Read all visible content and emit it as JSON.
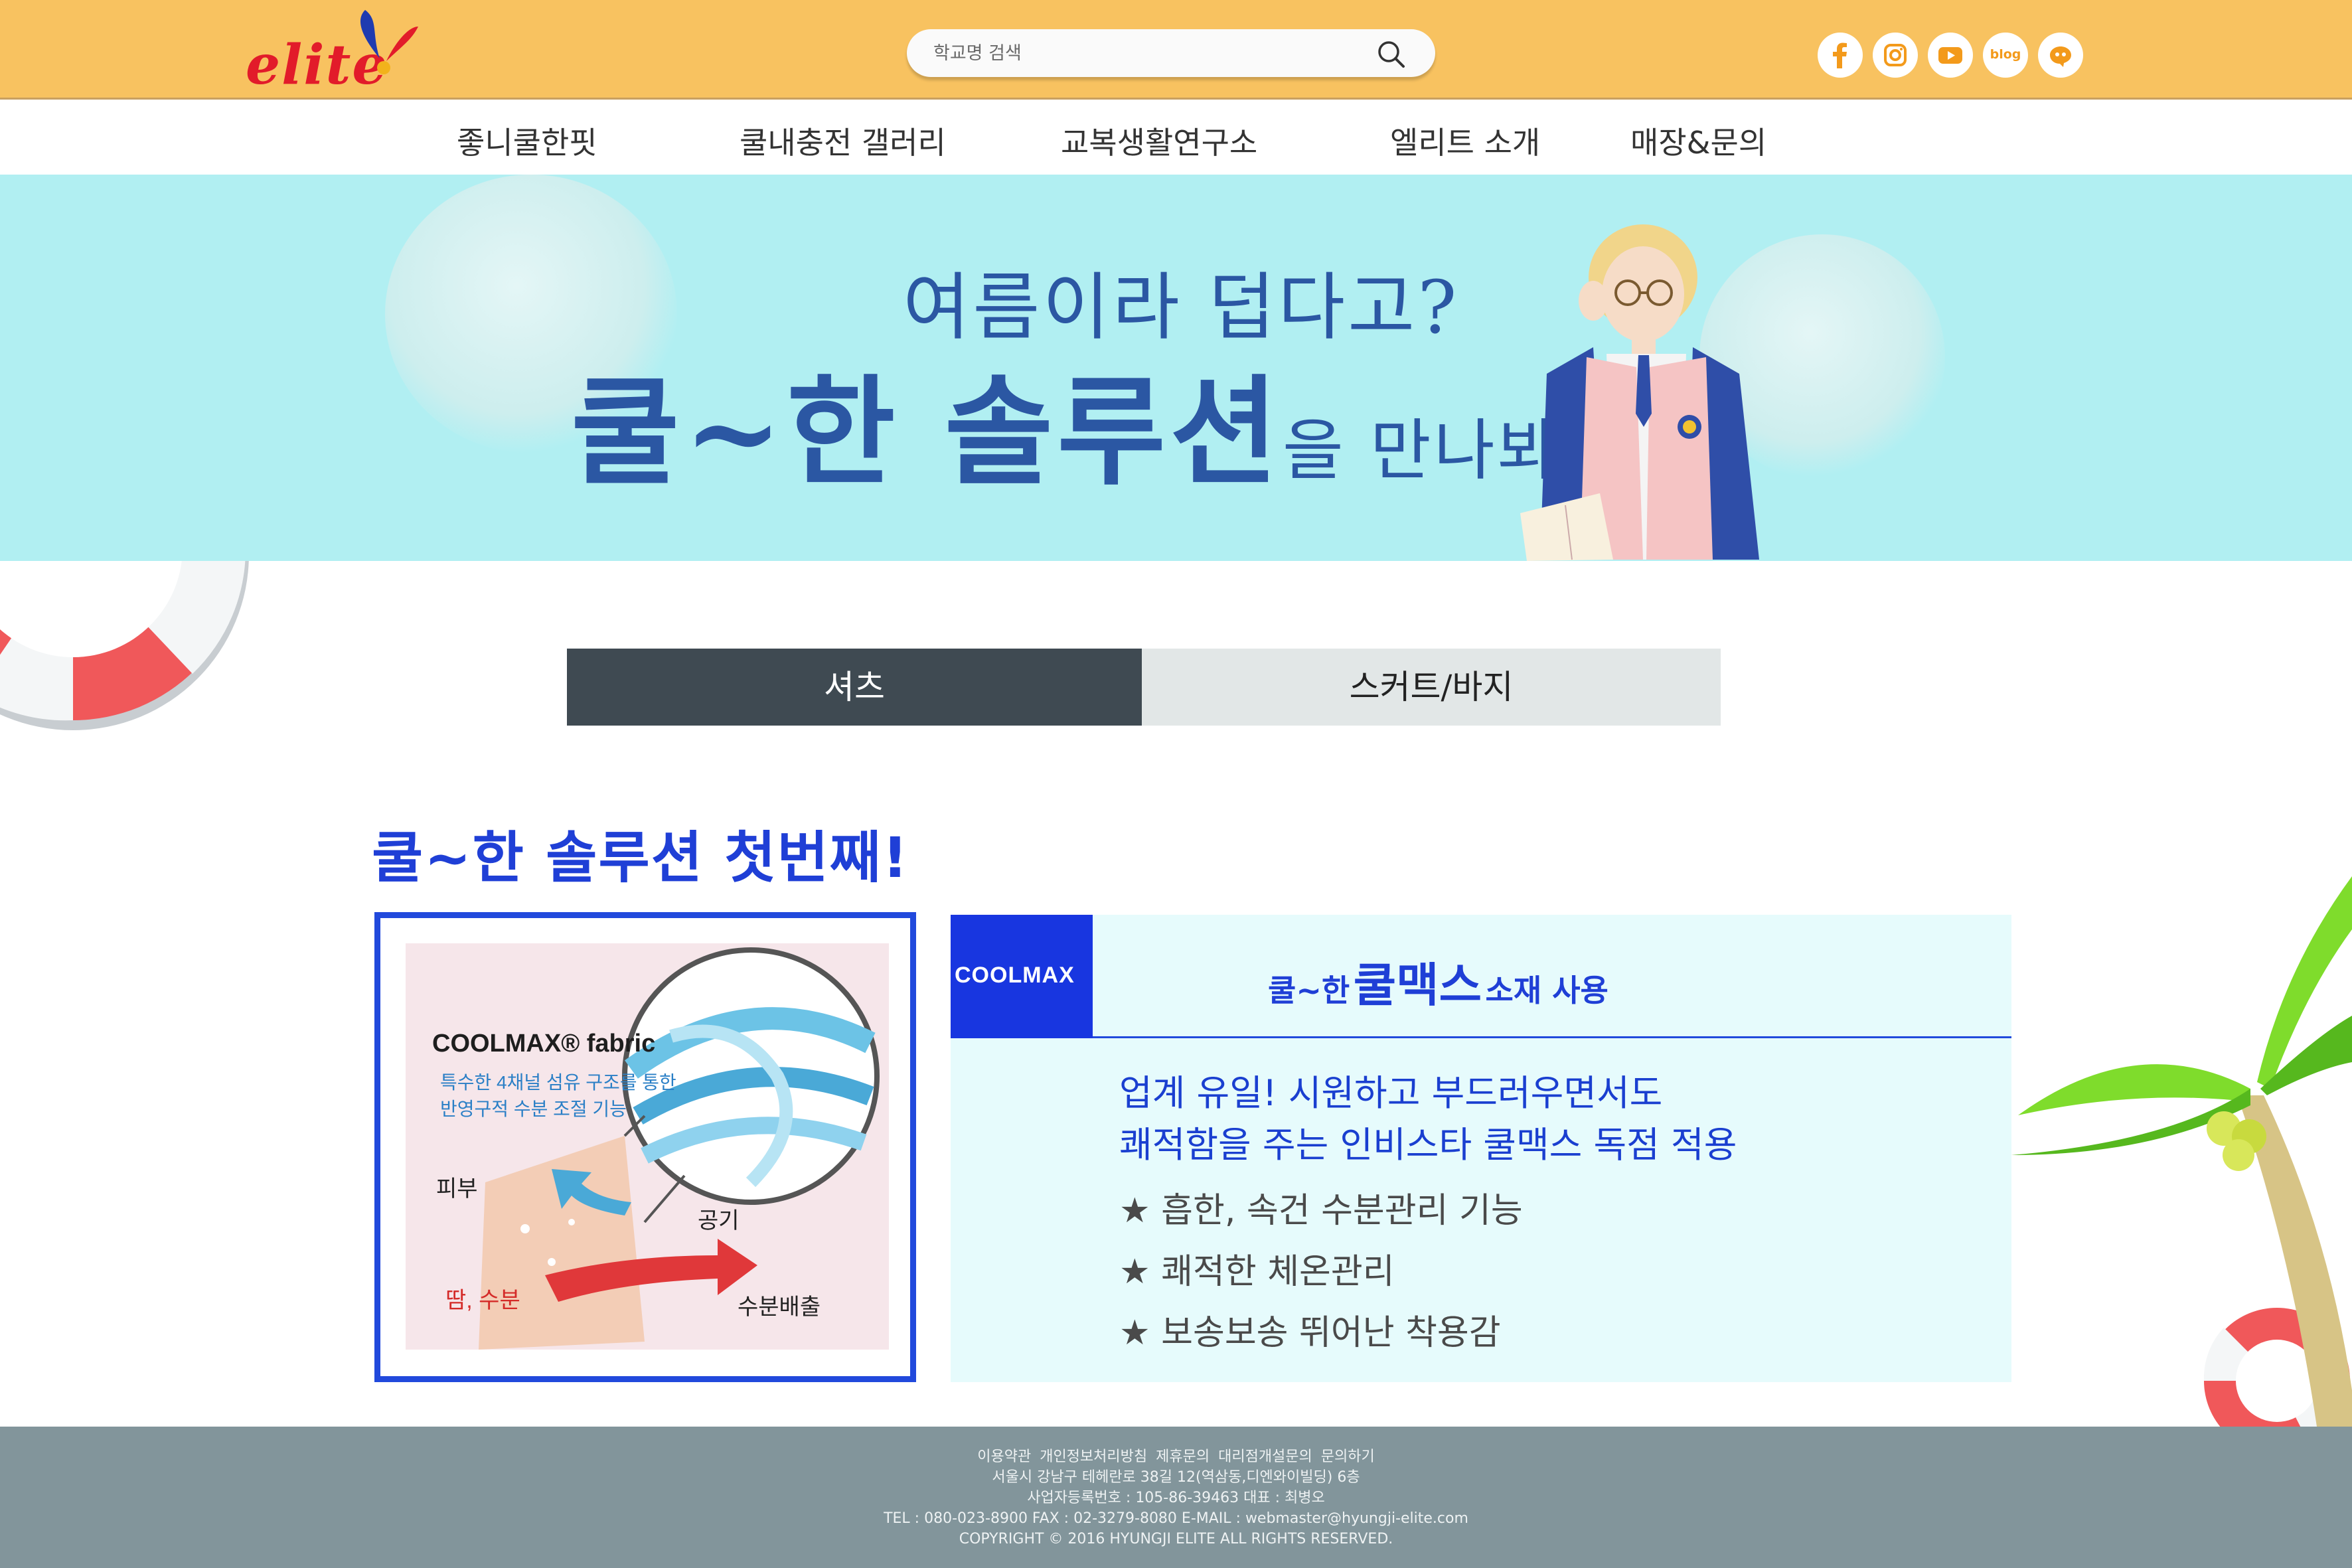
{
  "brand": {
    "logo_text": "elite"
  },
  "search": {
    "placeholder": "학교명 검색"
  },
  "socials": [
    {
      "icon": "facebook-icon"
    },
    {
      "icon": "instagram-icon"
    },
    {
      "icon": "youtube-icon"
    },
    {
      "icon": "blog-icon",
      "label": "blog"
    },
    {
      "icon": "kakao-story-icon"
    }
  ],
  "nav": {
    "items": [
      "좋니쿨한핏",
      "쿨내충전 갤러리",
      "교복생활연구소",
      "엘리트 소개",
      "매장&문의"
    ]
  },
  "hero": {
    "line1": "여름이라 덥다고?",
    "line2_big": "쿨~한 솔루션",
    "line2_small": "을 만나봐!"
  },
  "tabs": [
    {
      "label": "셔츠",
      "active": true
    },
    {
      "label": "스커트/바지",
      "active": false
    }
  ],
  "section": {
    "title": "쿨~한 솔루션 첫번째!",
    "image": {
      "title": "COOLMAX® fabric",
      "desc_line1": "특수한 4채널 섬유 구조를 통한",
      "desc_line2": "반영구적 수분 조절 기능",
      "label_skin": "피부",
      "label_air": "공기",
      "label_sweat": "땀, 수분",
      "label_release": "수분배출"
    },
    "info": {
      "logo_text": "COOLMAX",
      "head_prefix": "쿨~한",
      "head_big": "쿨맥스",
      "head_suffix": "소재 사용",
      "lead1": "업계 유일! 시원하고 부드러우면서도",
      "lead2": "쾌적함을 주는 인비스타 쿨맥스 독점 적용",
      "features": [
        "★ 흡한, 속건 수분관리 기능",
        "★ 쾌적한 체온관리",
        "★ 보송보송 뛰어난 착용감"
      ]
    }
  },
  "footer": {
    "links": [
      "이용약관",
      "개인정보처리방침",
      "제휴문의",
      "대리점개설문의",
      "문의하기"
    ],
    "address": "서울시 강남구 테헤란로 38길 12(역삼동,디엔와이빌딩) 6층",
    "biz": "사업자등록번호 : 105-86-39463    대표 : 최병오",
    "contact": "TEL : 080-023-8900    FAX : 02-3279-8080    E-MAIL : webmaster@hyungji-elite.com",
    "copyright": "COPYRIGHT © 2016 HYUNGJI ELITE ALL RIGHTS RESERVED."
  },
  "colors": {
    "header_bg": "#f8c260",
    "hero_bg": "#b1eff2",
    "accent_blue": "#2149dc",
    "tab_active": "#3f4a52",
    "footer_bg": "#82959b",
    "logo_red": "#e21b2a"
  }
}
